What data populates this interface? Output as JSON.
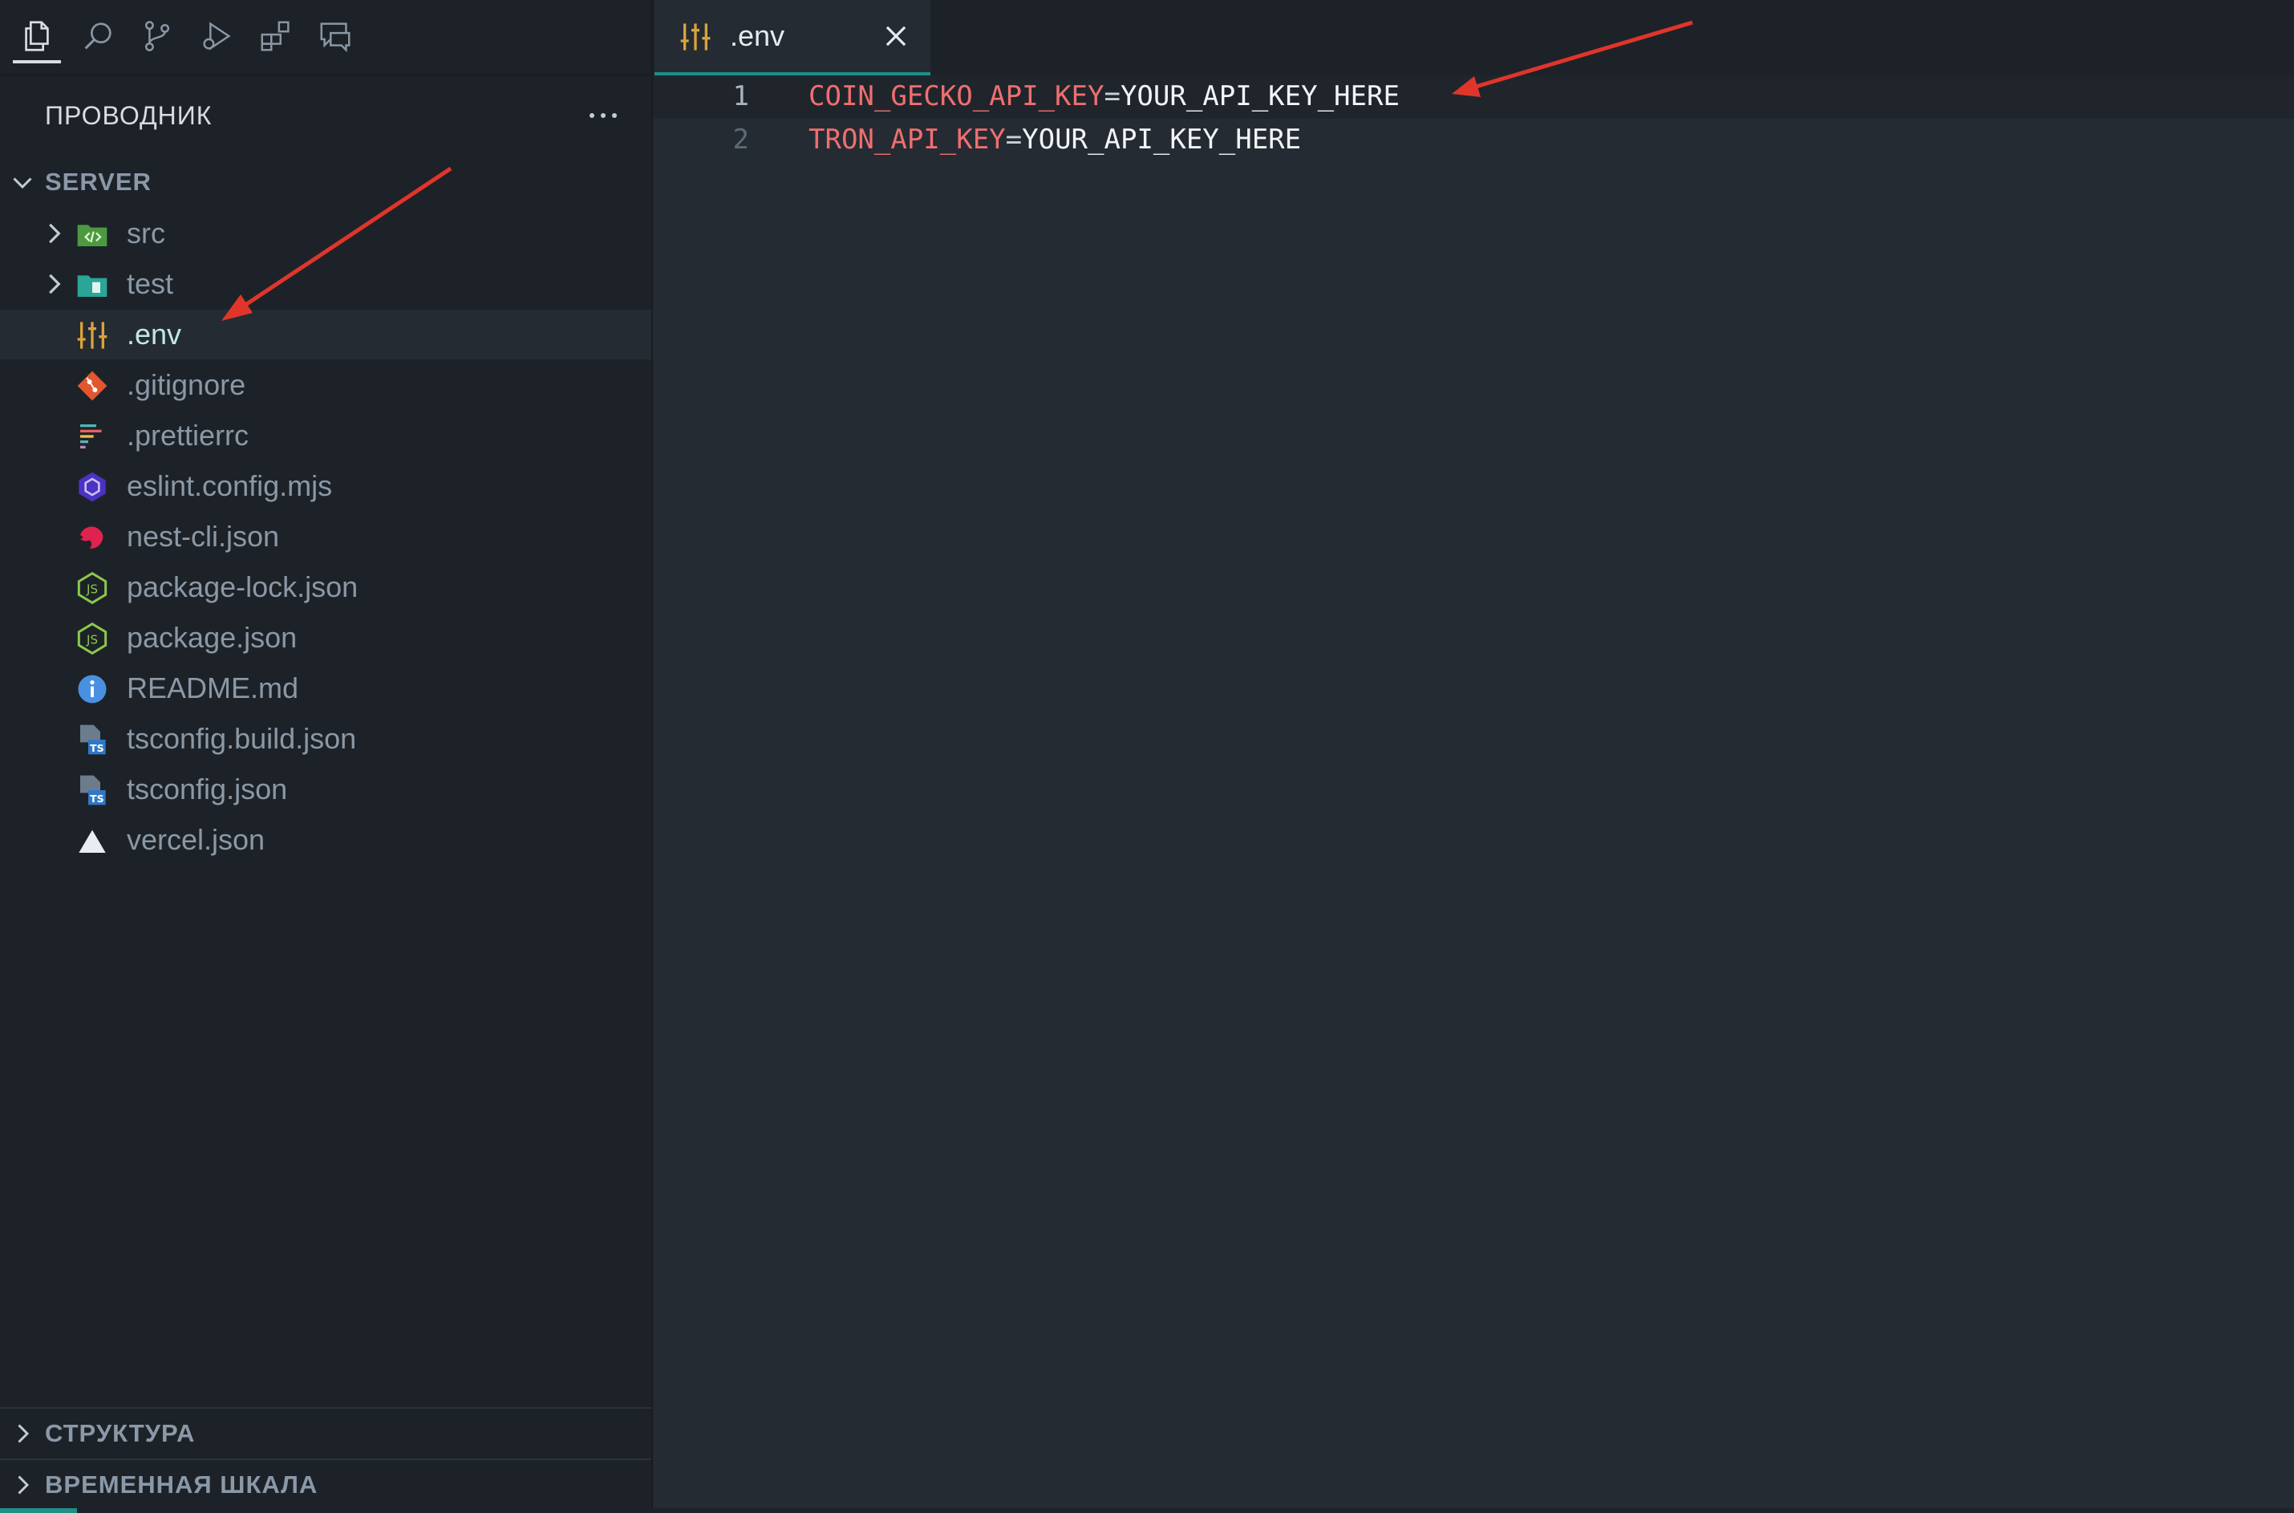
{
  "activity_bar": {
    "items": [
      {
        "name": "explorer",
        "icon": "files-icon"
      },
      {
        "name": "search",
        "icon": "search-icon"
      },
      {
        "name": "source-control",
        "icon": "source-control-icon"
      },
      {
        "name": "run-debug",
        "icon": "run-debug-icon"
      },
      {
        "name": "extensions",
        "icon": "extensions-icon"
      },
      {
        "name": "chat",
        "icon": "chat-icon"
      }
    ]
  },
  "explorer": {
    "title": "ПРОВОДНИК",
    "more_label": "···",
    "root": "SERVER",
    "items": [
      {
        "label": "src",
        "type": "folder",
        "icon": "folder-src-icon"
      },
      {
        "label": "test",
        "type": "folder",
        "icon": "folder-test-icon"
      },
      {
        "label": ".env",
        "type": "file",
        "icon": "env-icon",
        "selected": true
      },
      {
        "label": ".gitignore",
        "type": "file",
        "icon": "git-icon"
      },
      {
        "label": ".prettierrc",
        "type": "file",
        "icon": "prettier-icon"
      },
      {
        "label": "eslint.config.mjs",
        "type": "file",
        "icon": "eslint-icon"
      },
      {
        "label": "nest-cli.json",
        "type": "file",
        "icon": "nest-icon"
      },
      {
        "label": "package-lock.json",
        "type": "file",
        "icon": "nodejs-icon"
      },
      {
        "label": "package.json",
        "type": "file",
        "icon": "nodejs-icon"
      },
      {
        "label": "README.md",
        "type": "file",
        "icon": "info-icon"
      },
      {
        "label": "tsconfig.build.json",
        "type": "file",
        "icon": "tsconfig-icon"
      },
      {
        "label": "tsconfig.json",
        "type": "file",
        "icon": "tsconfig-icon"
      },
      {
        "label": "vercel.json",
        "type": "file",
        "icon": "vercel-icon"
      }
    ],
    "sections": {
      "outline": "СТРУКТУРА",
      "timeline": "ВРЕМЕННАЯ ШКАЛА"
    }
  },
  "editor": {
    "tab": {
      "label": ".env",
      "icon": "env-icon"
    },
    "lines": [
      {
        "num": "1",
        "key": "COIN_GECKO_API_KEY",
        "eq": "=",
        "value": "YOUR_API_KEY_HERE"
      },
      {
        "num": "2",
        "key": "TRON_API_KEY",
        "eq": "=",
        "value": "YOUR_API_KEY_HERE"
      }
    ]
  },
  "colors": {
    "accent": "#1e8f86",
    "env_key": "#ef6f6f",
    "arrow": "#e0352b"
  }
}
